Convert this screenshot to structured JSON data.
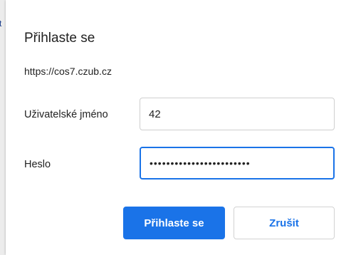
{
  "background": {
    "edge_glyph": "t"
  },
  "dialog": {
    "title": "Přihlaste se",
    "origin": "https://cos7.czub.cz",
    "username": {
      "label": "Uživatelské jméno",
      "value": "42"
    },
    "password": {
      "label": "Heslo",
      "value": "••••••••••••••••••••••••"
    },
    "buttons": {
      "submit_label": "Přihlaste se",
      "cancel_label": "Zrušit"
    }
  },
  "colors": {
    "accent": "#1a73e8",
    "text": "#222222",
    "field_border": "#cfcfcf"
  }
}
